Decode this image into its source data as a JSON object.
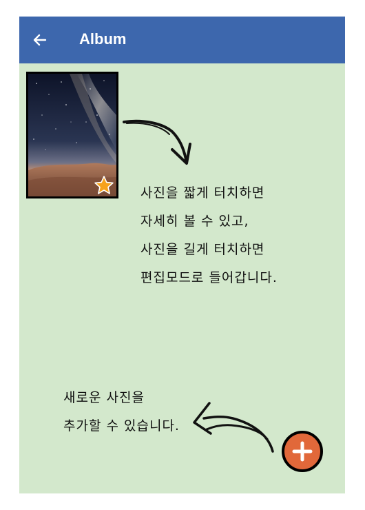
{
  "appbar": {
    "title": "Album",
    "back_icon": "arrow-left-icon",
    "color": "#3d67ad"
  },
  "screen": {
    "background": "#d3e8cc"
  },
  "album": {
    "photos": [
      {
        "subject": "milky-way-over-desert",
        "favorite": true,
        "favorite_icon": "star-icon"
      }
    ]
  },
  "hints": {
    "photo_hint": [
      "사진을 짧게 터치하면",
      "자세히 볼 수 있고,",
      "사진을 길게 터치하면",
      "편집모드로 들어갑니다."
    ],
    "add_hint": [
      "새로운 사진을",
      "추가할 수 있습니다."
    ]
  },
  "fab": {
    "icon": "plus-icon",
    "color": "#e1683a"
  }
}
